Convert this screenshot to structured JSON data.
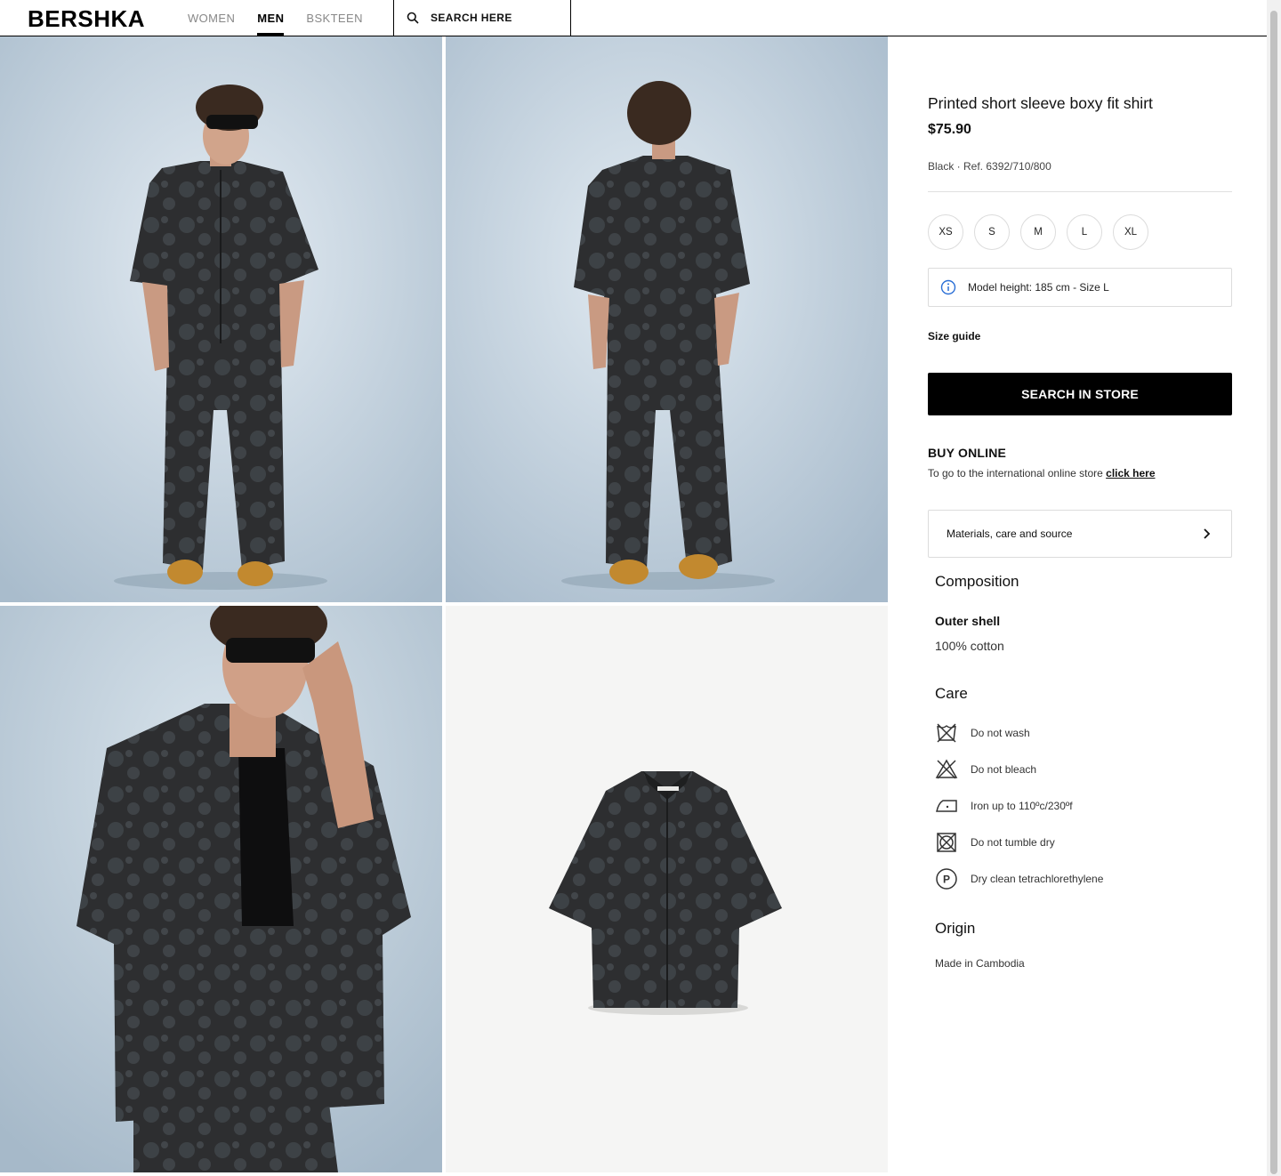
{
  "header": {
    "logo": "BERSHKA",
    "nav": [
      {
        "label": "WOMEN",
        "active": false
      },
      {
        "label": "MEN",
        "active": true
      },
      {
        "label": "BSKTEEN",
        "active": false
      }
    ],
    "search_placeholder": "SEARCH HERE"
  },
  "product": {
    "title": "Printed short sleeve boxy fit shirt",
    "price": "$75.90",
    "color_ref": "Black · Ref. 6392/710/800",
    "sizes": [
      "XS",
      "S",
      "M",
      "L",
      "XL"
    ],
    "model_info": "Model height: 185 cm - Size L",
    "size_guide": "Size guide",
    "search_in_store": "SEARCH IN STORE",
    "buy_online_title": "BUY ONLINE",
    "buy_online_text": "To go to the international online store ",
    "buy_online_link": "click here",
    "materials_label": "Materials, care and source"
  },
  "composition": {
    "title": "Composition",
    "part": "Outer shell",
    "value": "100% cotton"
  },
  "care": {
    "title": "Care",
    "items": [
      {
        "icon": "do-not-wash-icon",
        "label": "Do not wash"
      },
      {
        "icon": "do-not-bleach-icon",
        "label": "Do not bleach"
      },
      {
        "icon": "iron-icon",
        "label": "Iron up to 110ºc/230ºf"
      },
      {
        "icon": "do-not-tumble-dry-icon",
        "label": "Do not tumble dry"
      },
      {
        "icon": "dry-clean-p-icon",
        "label": "Dry clean tetrachlorethylene"
      }
    ]
  },
  "origin": {
    "title": "Origin",
    "value": "Made in Cambodia"
  },
  "colors": {
    "studio_background": "#cbd8e3",
    "garment": "#2e2f31",
    "product_background": "#f5f5f4",
    "button": "#000000"
  }
}
